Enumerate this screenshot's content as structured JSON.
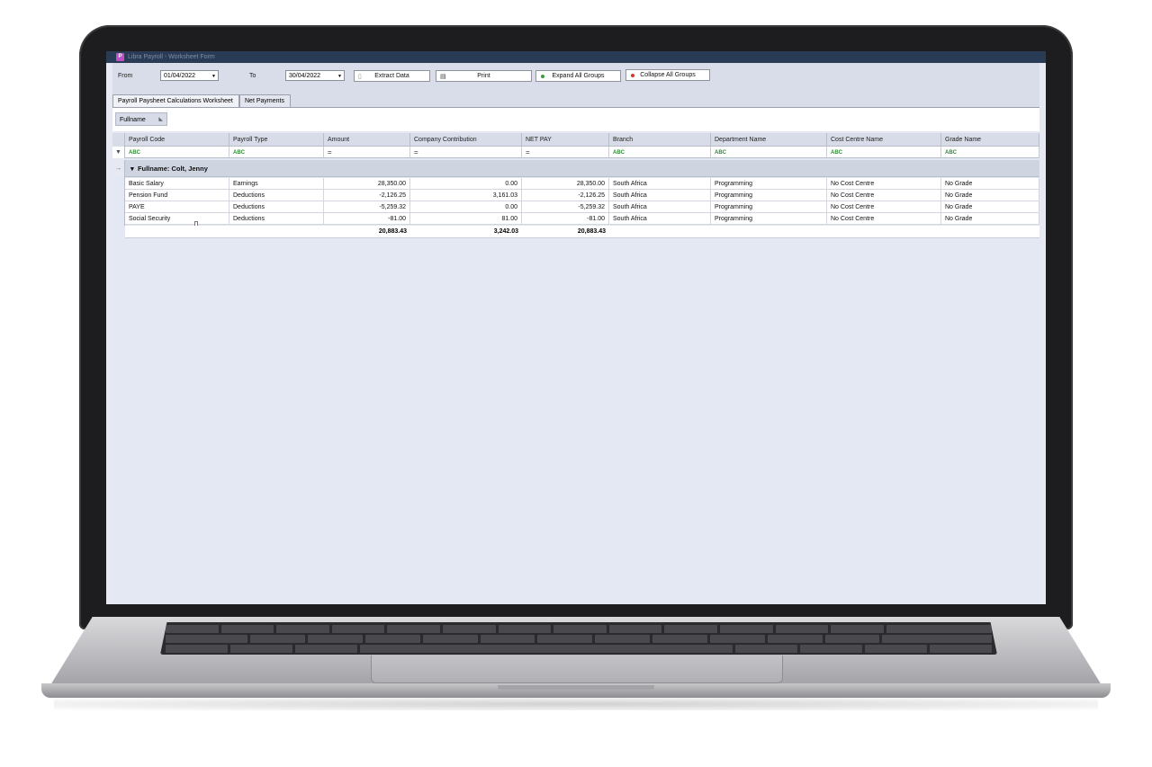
{
  "window": {
    "title": "Libra Payroll - Worksheet Form",
    "icon_letter": "P"
  },
  "toolbar": {
    "from_label": "From",
    "from_value": "01/04/2022",
    "to_label": "To",
    "to_value": "30/04/2022",
    "extract_label": "Extract Data",
    "print_label": "Print",
    "expand_label": "Expand All Groups",
    "collapse_label": "Collapse All Groups"
  },
  "tabs": [
    {
      "label": "Payroll Paysheet Calculations Worksheet",
      "active": true
    },
    {
      "label": "Net Payments",
      "active": false
    }
  ],
  "group_panel": {
    "chip_label": "Fullname"
  },
  "columns": [
    "Payroll Code",
    "Payroll Type",
    "Amount",
    "Company Contribution",
    "NET PAY",
    "Branch",
    "Department Name",
    "Cost Centre Name",
    "Grade Name"
  ],
  "filter_symbols": {
    "text": "ABC",
    "numeric": "="
  },
  "group": {
    "label": "Fullname: Colt, Jenny"
  },
  "rows": [
    [
      "Basic Salary",
      "Earnings",
      "28,350.00",
      "0.00",
      "28,350.00",
      "South Africa",
      "Programming",
      "No Cost Centre",
      "No Grade"
    ],
    [
      "Pension Fund",
      "Deductions",
      "-2,126.25",
      "3,161.03",
      "-2,126.25",
      "South Africa",
      "Programming",
      "No Cost Centre",
      "No Grade"
    ],
    [
      "PAYE",
      "Deductions",
      "-5,259.32",
      "0.00",
      "-5,259.32",
      "South Africa",
      "Programming",
      "No Cost Centre",
      "No Grade"
    ],
    [
      "Social Security",
      "Deductions",
      "-81.00",
      "81.00",
      "-81.00",
      "South Africa",
      "Programming",
      "No Cost Centre",
      "No Grade"
    ]
  ],
  "totals": {
    "amount": "20,883.43",
    "company_contribution": "3,242.03",
    "net_pay": "20,883.43"
  },
  "colors": {
    "titlebar": "#2a3b55",
    "accent": "#c04fc8",
    "screen_bg": "#e6e9f1"
  }
}
